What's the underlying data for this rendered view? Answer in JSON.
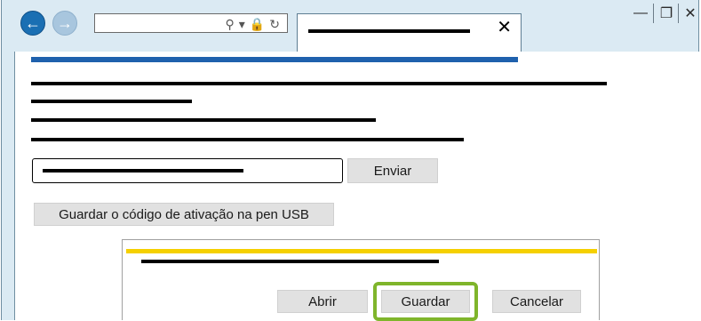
{
  "browser": {
    "back_icon": "arrow-left-icon",
    "forward_icon": "arrow-right-icon",
    "address_icons": [
      "search-icon",
      "dropdown-icon",
      "lock-icon",
      "refresh-icon"
    ],
    "tab_close_icon": "close-icon",
    "window_controls": [
      "minimize-icon",
      "maximize-icon",
      "close-icon"
    ]
  },
  "page": {
    "send_label": "Enviar",
    "usb_save_label": "Guardar o código de ativação na pen USB"
  },
  "dialog": {
    "open_label": "Abrir",
    "save_label": "Guardar",
    "cancel_label": "Cancelar"
  },
  "colors": {
    "accent_blue": "#1f61ad",
    "dialog_yellow": "#f5d000",
    "highlight_green": "#7fb52b"
  }
}
